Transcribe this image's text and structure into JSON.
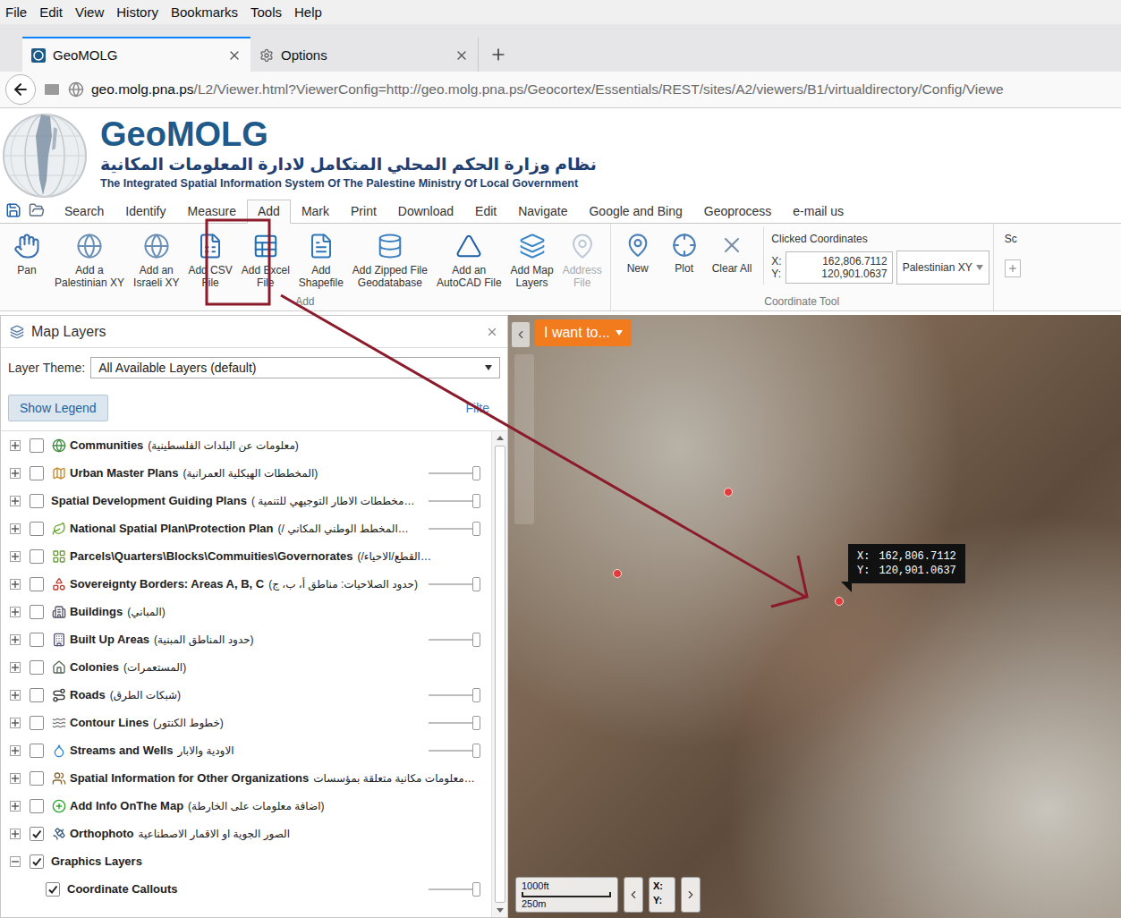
{
  "browser": {
    "menu": [
      "File",
      "Edit",
      "View",
      "History",
      "Bookmarks",
      "Tools",
      "Help"
    ],
    "tabs": [
      {
        "label": "GeoMOLG",
        "selected": true
      },
      {
        "label": "Options",
        "selected": false
      }
    ],
    "url": {
      "host": "geo.molg.pna.ps",
      "path": "/L2/Viewer.html?ViewerConfig=http://geo.molg.pna.ps/Geocortex/Essentials/REST/sites/A2/viewers/B1/virtualdirectory/Config/Viewe"
    }
  },
  "header": {
    "title": "GeoMOLG",
    "subtitle_ar": "نظام وزارة الحكم المحلي المتكامل لادارة المعلومات المكانية",
    "subtitle_en": "The Integrated Spatial Information System Of The Palestine Ministry Of Local Government"
  },
  "menu_tabs": [
    {
      "label": "Search",
      "selected": false
    },
    {
      "label": "Identify",
      "selected": false
    },
    {
      "label": "Measure",
      "selected": false
    },
    {
      "label": "Add",
      "selected": true
    },
    {
      "label": "Mark",
      "selected": false
    },
    {
      "label": "Print",
      "selected": false
    },
    {
      "label": "Download",
      "selected": false
    },
    {
      "label": "Edit",
      "selected": false
    },
    {
      "label": "Navigate",
      "selected": false
    },
    {
      "label": "Google and Bing",
      "selected": false
    },
    {
      "label": "Geoprocess",
      "selected": false
    },
    {
      "label": "e-mail us",
      "selected": false
    }
  ],
  "ribbon": {
    "add_group": {
      "label": "Add",
      "buttons": [
        {
          "label": "Pan",
          "disabled": false
        },
        {
          "label": "Add a\nPalestinian XY",
          "disabled": false
        },
        {
          "label": "Add an\nIsraeli XY",
          "disabled": false
        },
        {
          "label": "Add CSV\nFile",
          "disabled": false
        },
        {
          "label": "Add Excel\nFile",
          "disabled": false
        },
        {
          "label": "Add\nShapefile",
          "disabled": false
        },
        {
          "label": "Add Zipped File\nGeodatabase",
          "disabled": false
        },
        {
          "label": "Add an\nAutoCAD File",
          "disabled": false
        },
        {
          "label": "Add Map\nLayers",
          "disabled": false
        },
        {
          "label": "Address\nFile",
          "disabled": true
        }
      ]
    },
    "coordinate_group": {
      "label": "Coordinate Tool",
      "buttons": [
        {
          "label": "New",
          "disabled": false
        },
        {
          "label": "Plot",
          "disabled": false
        },
        {
          "label": "Clear All",
          "disabled": false
        }
      ],
      "clicked_label": "Clicked Coordinates",
      "x_label": "X:",
      "y_label": "Y:",
      "x": "162,806.7112",
      "y": "120,901.0637",
      "system": "Palestinian XY"
    },
    "next_group": {
      "label": "Sc"
    }
  },
  "layers_panel": {
    "title": "Map Layers",
    "theme_label": "Layer Theme:",
    "theme": "All Available Layers (default)",
    "legend_button": "Show Legend",
    "filter": "Filte",
    "layers": [
      {
        "name": "Communities",
        "note": "(معلومات عن البلدات الفلسطينية)",
        "checked": false,
        "expanded": false,
        "kind": "plain"
      },
      {
        "name": "Urban Master Plans",
        "note": "(المخططات الهيكلية العمرانية)",
        "checked": false,
        "expanded": false,
        "kind": "slider",
        "level": 1
      },
      {
        "name": "Spatial Development Guiding Plans",
        "note": "( مخططات الاطار التوجيهي للتنمية…",
        "checked": false,
        "expanded": false,
        "kind": "slider",
        "level": 1
      },
      {
        "name": "National Spatial Plan\\Protection Plan",
        "note": "(/ المخطط الوطني المكاني…",
        "checked": false,
        "expanded": false,
        "kind": "slider",
        "level": 1
      },
      {
        "name": "Parcels\\Quarters\\Blocks\\Commuities\\Governorates",
        "note": "(/القطع/الاحياء…",
        "checked": false,
        "expanded": false,
        "kind": "plain"
      },
      {
        "name": "Sovereignty Borders: Areas A, B, C",
        "note": "(حدود الصلاحيات: مناطق أ، ب، ج)",
        "checked": false,
        "expanded": false,
        "kind": "slider",
        "level": 1
      },
      {
        "name": "Buildings",
        "note": "(المباني)",
        "checked": false,
        "expanded": false,
        "kind": "plain"
      },
      {
        "name": "Built Up Areas",
        "note": "(حدود المناطق المبنية)",
        "checked": false,
        "expanded": false,
        "kind": "slider",
        "level": 1
      },
      {
        "name": "Colonies",
        "note": "(المستعمرات)",
        "checked": false,
        "expanded": false,
        "kind": "plain"
      },
      {
        "name": "Roads",
        "note": "(شبكات الطرق)",
        "checked": false,
        "expanded": false,
        "kind": "slider",
        "level": 1
      },
      {
        "name": "Contour Lines",
        "note": "(خطوط الكنتور)",
        "checked": false,
        "expanded": false,
        "kind": "slider",
        "level": 1
      },
      {
        "name": "Streams and Wells",
        "note": "الاودية والابار",
        "checked": false,
        "expanded": false,
        "kind": "slider",
        "level": 1
      },
      {
        "name": "Spatial Information for Other Organizations",
        "note": "معلومات مكانية متعلقة بمؤسسات…",
        "checked": false,
        "expanded": false,
        "kind": "plain"
      },
      {
        "name": "Add Info OnThe Map",
        "note": "(اضافة معلومات على الخارطة)",
        "checked": false,
        "expanded": false,
        "kind": "plain"
      },
      {
        "name": "Orthophoto",
        "note": "الصور الجوية او الاقمار الاصطناعية",
        "checked": true,
        "expanded": false,
        "kind": "plain"
      },
      {
        "name": "Graphics Layers",
        "checked": true,
        "expanded": true,
        "kind": "plain",
        "children": [
          {
            "name": "Coordinate Callouts",
            "checked": true,
            "kind": "slider",
            "level": 1
          }
        ]
      }
    ]
  },
  "map": {
    "menu_button": "I want to...",
    "callout": {
      "x_label": "X:",
      "x": "162,806.7112",
      "y_label": "Y:",
      "y": "120,901.0637"
    },
    "scale": {
      "imperial": "1000ft",
      "metric": "250m"
    },
    "coords": {
      "x_label": "X:",
      "y_label": "Y:"
    }
  }
}
